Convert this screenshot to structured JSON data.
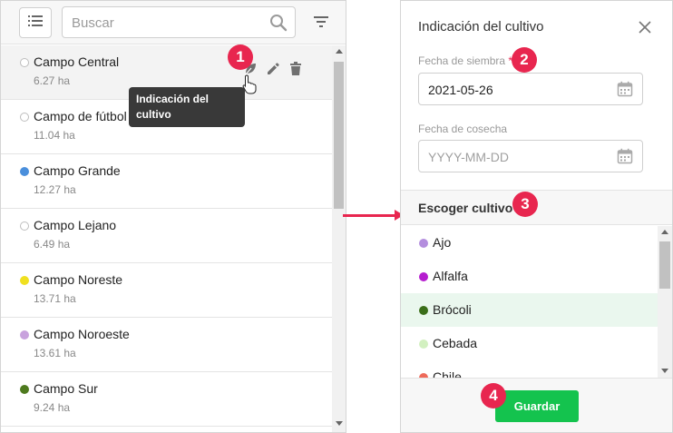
{
  "left": {
    "search_placeholder": "Buscar",
    "tooltip": {
      "line1": "Indicación del",
      "line2": "cultivo"
    },
    "fields": [
      {
        "name": "Campo Central",
        "area": "6.27 ha",
        "color": "",
        "selected": true
      },
      {
        "name": "Campo de fútbol",
        "area": "11.04 ha",
        "color": ""
      },
      {
        "name": "Campo Grande",
        "area": "12.27 ha",
        "color": "#4a8fdc"
      },
      {
        "name": "Campo Lejano",
        "area": "6.49 ha",
        "color": ""
      },
      {
        "name": "Campo Noreste",
        "area": "13.71 ha",
        "color": "#f0e020"
      },
      {
        "name": "Campo Noroeste",
        "area": "13.61 ha",
        "color": "#c8a2dd"
      },
      {
        "name": "Campo Sur",
        "area": "9.24 ha",
        "color": "#4e7a1e"
      }
    ]
  },
  "right": {
    "title": "Indicación del cultivo",
    "sowing_label": "Fecha de siembra",
    "required_mark": "*",
    "sowing_value": "2021-05-26",
    "harvest_label": "Fecha de cosecha",
    "harvest_placeholder": "YYYY-MM-DD",
    "choose_crop": "Escoger cultivo",
    "crops": [
      {
        "name": "Ajo",
        "color": "#b48ede"
      },
      {
        "name": "Alfalfa",
        "color": "#b51dcf"
      },
      {
        "name": "Brócoli",
        "color": "#3b6e1a"
      },
      {
        "name": "Cebada",
        "color": "#d2f0c0"
      },
      {
        "name": "Chile",
        "color": "#ee6a5a"
      }
    ],
    "save_label": "Guardar"
  },
  "badges": [
    "1",
    "2",
    "3",
    "4"
  ],
  "colors": {
    "accent": "#e8264f",
    "save": "#14c34e",
    "highlight": "#eaf7ee"
  }
}
